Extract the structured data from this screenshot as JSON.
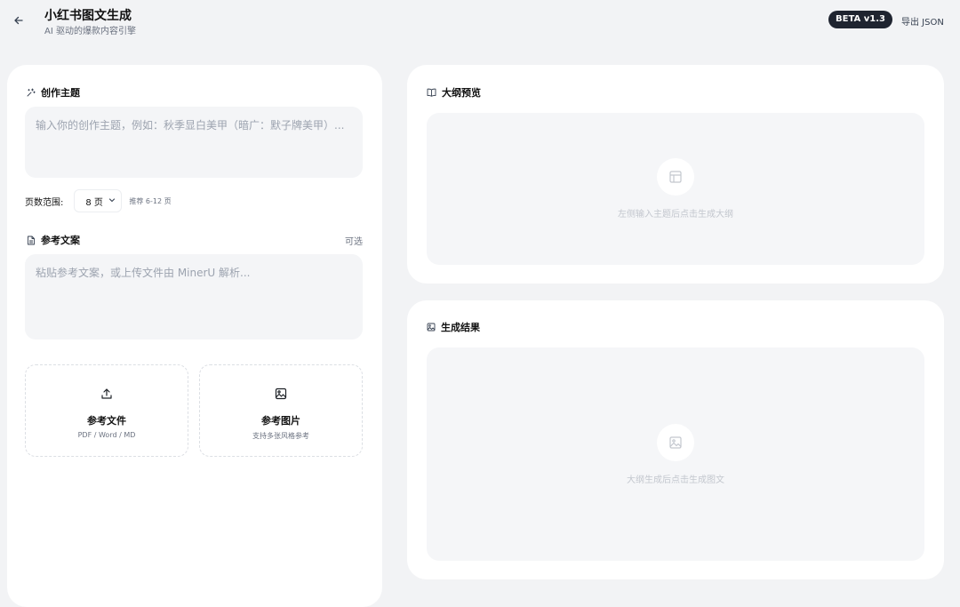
{
  "header": {
    "title": "小红书图文生成",
    "subtitle": "AI 驱动的爆款内容引擎",
    "badge": "BETA v1.3",
    "export_label": "导出 JSON"
  },
  "left": {
    "topic": {
      "heading": "创作主题",
      "placeholder": "输入你的创作主题，例如：秋季显白美甲（暗广：默子牌美甲）..."
    },
    "pages": {
      "label": "页数范围:",
      "value": "8 页",
      "hint": "推荐 6-12 页"
    },
    "reference": {
      "heading": "参考文案",
      "optional": "可选",
      "placeholder": "粘贴参考文案，或上传文件由 MinerU 解析..."
    },
    "uploads": [
      {
        "label": "参考文件",
        "sub": "PDF / Word / MD",
        "icon": "upload-icon"
      },
      {
        "label": "参考图片",
        "sub": "支持多张风格参考",
        "icon": "image-icon"
      }
    ]
  },
  "outline": {
    "heading": "大纲预览",
    "empty_text": "左侧输入主题后点击生成大纲",
    "icon": "layout-icon"
  },
  "result": {
    "heading": "生成结果",
    "empty_text": "大纲生成后点击生成图文",
    "icon": "image-icon"
  }
}
